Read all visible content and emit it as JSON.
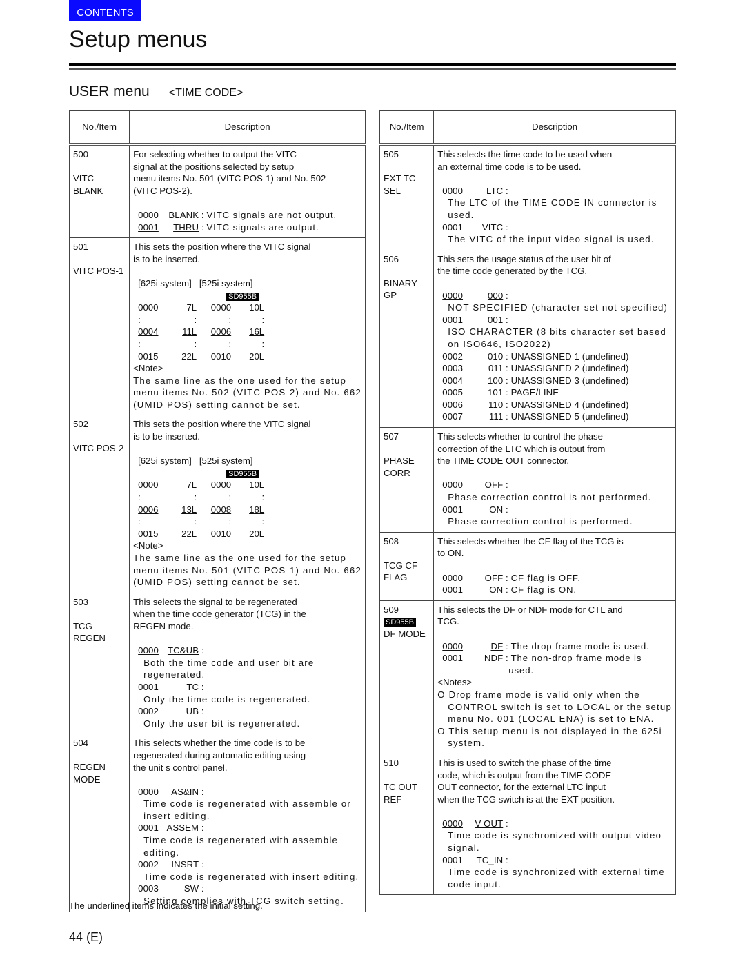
{
  "header": {
    "contents_button": "CONTENTS",
    "page_title": "Setup menus",
    "section_title": "USER menu",
    "section_subtitle": "<TIME CODE>"
  },
  "table_headers": {
    "no_item": "No./Item",
    "description": "Description"
  },
  "badge_label": "SD955B",
  "left_items": [
    {
      "no": "500",
      "name": "VITC BLANK",
      "desc": [
        "For selecting whether to output the VITC",
        "signal at the positions selected by setup",
        "menu items No. 501 (VITC POS-1) and No. 502",
        "(VITC POS-2)."
      ],
      "options": [
        {
          "code": "0000",
          "label": "BLANK",
          "text": "VITC signals are not output.",
          "default": false
        },
        {
          "code": "0001",
          "label": "THRU",
          "text": "VITC signals are output.",
          "default": true
        }
      ]
    },
    {
      "no": "501",
      "name": "VITC POS-1",
      "desc": [
        "This sets the position where the VITC signal",
        "is to be inserted."
      ],
      "systems": "[625i system]   [525i system]",
      "grid": [
        [
          "0000",
          "7L",
          "0000",
          "10L"
        ],
        [
          ":",
          ":",
          ":",
          ":"
        ],
        [
          "0004",
          "11L",
          "0006",
          "16L"
        ],
        [
          ":",
          ":",
          ":",
          ":"
        ],
        [
          "0015",
          "22L",
          "0010",
          "20L"
        ]
      ],
      "note_label": "<Note>",
      "note": [
        "The same line as the one used for the setup",
        "menu items No. 502 (VITC POS-2) and No. 662",
        "(UMID POS) setting cannot be set."
      ]
    },
    {
      "no": "502",
      "name": "VITC POS-2",
      "desc": [
        "This sets the position where the VITC signal",
        "is to be inserted."
      ],
      "systems": "[625i system]   [525i system]",
      "grid": [
        [
          "0000",
          "7L",
          "0000",
          "10L"
        ],
        [
          ":",
          ":",
          ":",
          ":"
        ],
        [
          "0006",
          "13L",
          "0008",
          "18L"
        ],
        [
          ":",
          ":",
          ":",
          ":"
        ],
        [
          "0015",
          "22L",
          "0010",
          "20L"
        ]
      ],
      "note_label": "<Note>",
      "note": [
        "The same line as the one used for the setup",
        "menu items No. 501 (VITC POS-1) and No. 662",
        "(UMID POS) setting cannot be set."
      ]
    },
    {
      "no": "503",
      "name": "TCG REGEN",
      "desc": [
        "This selects the signal to be regenerated",
        "when the time code generator (TCG) in the",
        "REGEN mode."
      ],
      "options": [
        {
          "code": "0000",
          "label": "TC&UB",
          "lines": [
            "Both  the  time  code  and  user  bit  are",
            "regenerated."
          ],
          "default": true
        },
        {
          "code": "0001",
          "label": "TC",
          "lines": [
            "Only the time code is regenerated."
          ],
          "default": false
        },
        {
          "code": "0002",
          "label": "UB",
          "lines": [
            "Only the user bit is regenerated."
          ],
          "default": false
        }
      ]
    },
    {
      "no": "504",
      "name": "REGEN MODE",
      "desc": [
        "This selects whether the time code is to be",
        "regenerated during automatic editing using",
        "the unit  s control panel."
      ],
      "options": [
        {
          "code": "0000",
          "label": "AS&IN",
          "lines": [
            "Time code is regenerated with assemble or",
            "insert editing."
          ],
          "default": true
        },
        {
          "code": "0001",
          "label": "ASSEM",
          "lines": [
            "Time  code  is  regenerated  with  assemble",
            "editing."
          ],
          "default": false
        },
        {
          "code": "0002",
          "label": "INSRT",
          "lines": [
            "Time code is regenerated with insert editing."
          ],
          "default": false
        },
        {
          "code": "0003",
          "label": "SW",
          "lines": [
            "Setting complies with TCG switch setting."
          ],
          "default": false
        }
      ]
    }
  ],
  "right_items": [
    {
      "no": "505",
      "name": "EXT TC SEL",
      "desc": [
        "This selects the time code to be used when",
        "an external time code is to be used."
      ],
      "options": [
        {
          "code": "0000",
          "label": "LTC",
          "lines": [
            "The LTC of the TIME CODE IN connector is",
            "used."
          ],
          "default": true
        },
        {
          "code": "0001",
          "label": "VITC",
          "lines": [
            "The VITC of the input video signal is used."
          ],
          "default": false
        }
      ]
    },
    {
      "no": "506",
      "name": "BINARY GP",
      "desc": [
        "This sets the usage status of the user bit of",
        "the time code generated by the TCG."
      ],
      "options": [
        {
          "code": "0000",
          "label": "000",
          "lines": [
            "NOT SPECIFIED (character set not specified)"
          ],
          "default": true
        },
        {
          "code": "0001",
          "label": "001",
          "lines": [
            "ISO CHARACTER (8 bits character set based",
            "on ISO646, ISO2022)"
          ],
          "default": false
        }
      ],
      "inline_options": [
        {
          "code": "0002",
          "label": "010",
          "text": "UNASSIGNED 1 (undefined)"
        },
        {
          "code": "0003",
          "label": "011",
          "text": "UNASSIGNED 2 (undefined)"
        },
        {
          "code": "0004",
          "label": "100",
          "text": "UNASSIGNED 3 (undefined)"
        },
        {
          "code": "0005",
          "label": "101",
          "text": "PAGE/LINE"
        },
        {
          "code": "0006",
          "label": "110",
          "text": "UNASSIGNED 4 (undefined)"
        },
        {
          "code": "0007",
          "label": "111",
          "text": "UNASSIGNED 5 (undefined)"
        }
      ]
    },
    {
      "no": "507",
      "name": "PHASE CORR",
      "desc": [
        "This selects whether to control the phase",
        "correction of the LTC which is output from",
        "the TIME CODE OUT connector."
      ],
      "options": [
        {
          "code": "0000",
          "label": "OFF",
          "lines": [
            "Phase correction control is not performed."
          ],
          "default": true
        },
        {
          "code": "0001",
          "label": "ON",
          "lines": [
            "Phase correction control is performed."
          ],
          "default": false
        }
      ]
    },
    {
      "no": "508",
      "name": "TCG CF FLAG",
      "desc": [
        "This selects whether the CF flag of the TCG is",
        "to ON."
      ],
      "options": [
        {
          "code": "0000",
          "label": "OFF",
          "text": "CF flag is OFF.",
          "default": true
        },
        {
          "code": "0001",
          "label": "ON",
          "text": "CF flag is ON.",
          "default": false
        }
      ]
    },
    {
      "no": "509",
      "name": "DF MODE",
      "badge": "SD955B",
      "desc": [
        "This selects the DF or NDF mode for CTL and",
        "TCG."
      ],
      "options": [
        {
          "code": "0000",
          "label": "DF",
          "text": "The drop frame mode is used.",
          "default": true
        },
        {
          "code": "0001",
          "label": "NDF",
          "text": "The  non-drop  frame  mode  is",
          "text2": "used.",
          "default": false
        }
      ],
      "notes_label": "<Notes>",
      "notes": [
        [
          "O Drop  frame  mode  is  valid  only  when  the",
          "CONTROL switch is set to LOCAL or the setup",
          "menu No. 001 (LOCAL ENA) is set to ENA."
        ],
        [
          "O This setup menu is not displayed in the 625i",
          "system."
        ]
      ]
    },
    {
      "no": "510",
      "name": "TC OUT REF",
      "desc": [
        "This is used to switch the phase of the time",
        "code, which is output from the TIME CODE",
        "OUT connector, for the external LTC input",
        "when the TCG switch is at the EXT position."
      ],
      "options": [
        {
          "code": "0000",
          "label": "V OUT",
          "lines": [
            "Time code is synchronized with output video",
            "signal."
          ],
          "default": true
        },
        {
          "code": "0001",
          "label": "TC_IN",
          "lines": [
            "Time code is synchronized with external time",
            "code input."
          ],
          "default": false
        }
      ]
    }
  ],
  "footnote": "The underlined items indicates the initial setting.",
  "page_number": "44 (E)"
}
